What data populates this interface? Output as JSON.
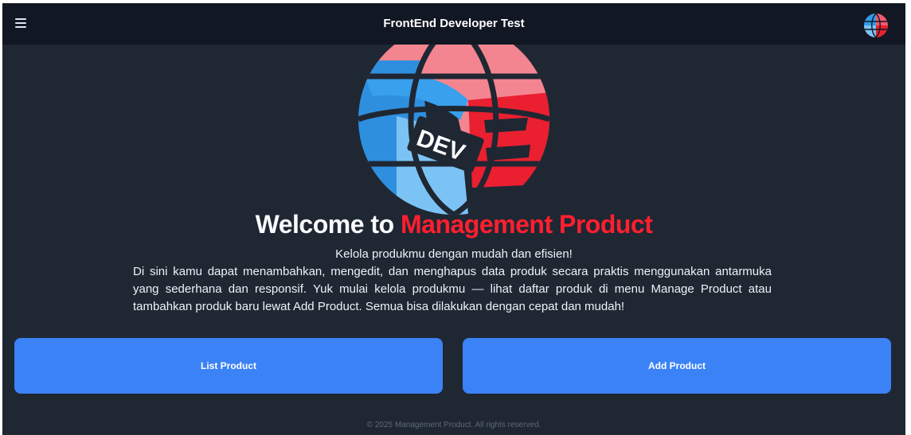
{
  "header": {
    "title": "FrontEnd Developer Test",
    "menu_icon": "hamburger-menu-icon",
    "avatar_icon": "globe-avatar-icon"
  },
  "hero": {
    "logo_icon": "dev-globe-logo-icon",
    "logo_text": "DEV",
    "headline_part1": "Welcome to",
    "headline_part2": "Management Product",
    "tagline": "Kelola produkmu dengan mudah dan efisien!",
    "description": "Di sini kamu dapat menambahkan, mengedit, dan menghapus data produk secara praktis menggunakan antarmuka yang sederhana dan responsif. Yuk mulai kelola produkmu — lihat daftar produk di menu Manage Product atau tambahkan produk baru lewat Add Product. Semua bisa dilakukan dengan cepat dan mudah!"
  },
  "actions": {
    "list_product": "List Product",
    "add_product": "Add Product"
  },
  "footer": {
    "text": "© 2025 Management Product. All rights reserved."
  },
  "colors": {
    "background": "#1f2733",
    "navbar": "#111723",
    "accent_red": "#ff1f2f",
    "button_blue": "#3b82f6"
  }
}
